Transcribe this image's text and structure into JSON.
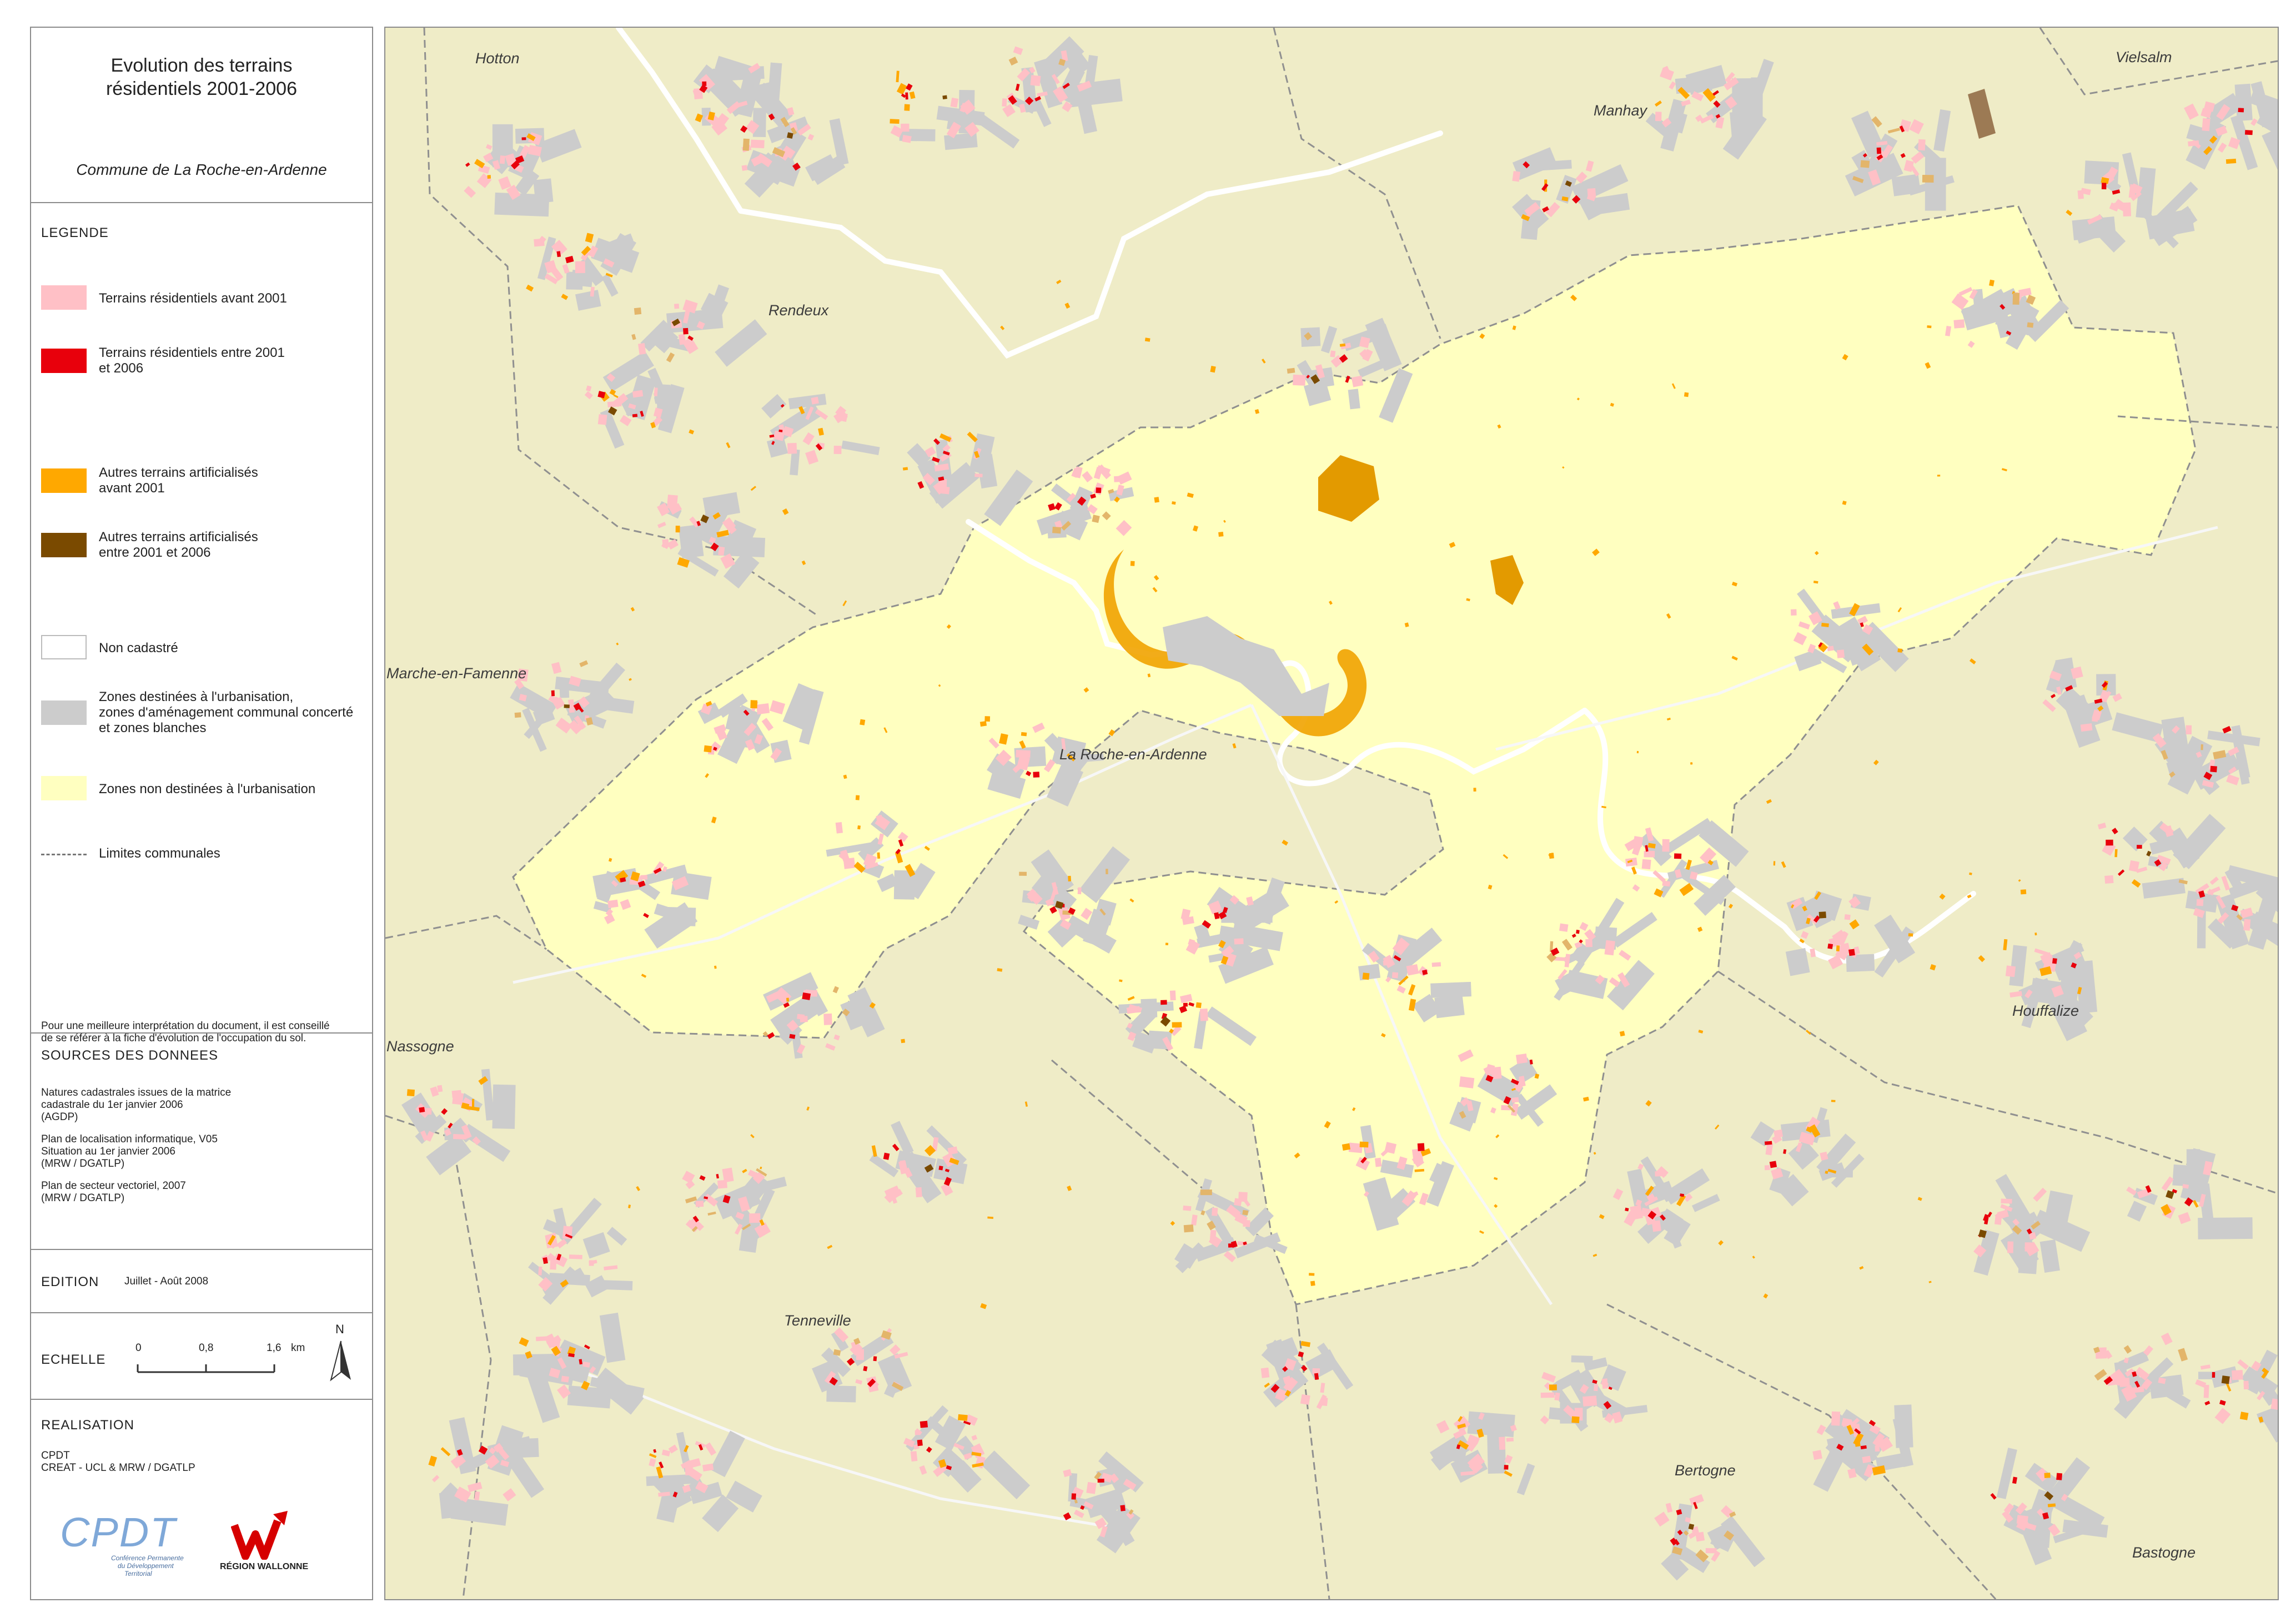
{
  "title_line1": "Evolution des terrains",
  "title_line2": "résidentiels 2001-2006",
  "commune": "Commune de La Roche-en-Ardenne",
  "legend": {
    "heading": "LEGENDE",
    "items": [
      {
        "label1": "Terrains résidentiels avant 2001",
        "label2": "",
        "color": "#ffc0c6"
      },
      {
        "label1": "Terrains résidentiels entre 2001",
        "label2": "et 2006",
        "color": "#e8000c"
      },
      {
        "label1": "Autres terrains artificialisés",
        "label2": "avant 2001",
        "color": "#ffa800"
      },
      {
        "label1": "Autres terrains artificialisés",
        "label2": "entre 2001 et 2006",
        "color": "#7a4a00"
      },
      {
        "label1": "Non cadastré",
        "label2": "",
        "color": "#ffffff"
      },
      {
        "label1": "Zones destinées à l'urbanisation,",
        "label2": "zones d'aménagement communal concerté",
        "label3": "et zones blanches",
        "color": "#cccccc"
      },
      {
        "label1": "Zones non destinées à l'urbanisation",
        "label2": "",
        "color": "#ffffc0"
      }
    ],
    "boundary_label": "Limites communales",
    "note1": "Pour une meilleure interprétation du document, il est conseillé",
    "note2": "de se référer à la fiche d'évolution de l'occupation du sol."
  },
  "sources": {
    "heading": "SOURCES DES DONNEES",
    "lines": [
      "Natures cadastrales issues de la matrice",
      "cadastrale du 1er janvier 2006",
      "(AGDP)",
      "Plan de localisation informatique, V05",
      "Situation au 1er janvier 2006",
      "(MRW / DGATLP)",
      "Plan de secteur vectoriel, 2007",
      "(MRW / DGATLP)"
    ]
  },
  "edition": {
    "heading": "EDITION",
    "value": "Juillet - Août 2008"
  },
  "scale": {
    "heading": "ECHELLE",
    "t0": "0",
    "t1": "0,8",
    "t2": "1,6",
    "unit": "km",
    "north": "N"
  },
  "realisation": {
    "heading": "REALISATION",
    "line1": "CPDT",
    "line2": "CREAT - UCL & MRW / DGATLP",
    "cpdt_logo": "CPDT",
    "cpdt_small1": "Conférence Permanente",
    "cpdt_small2": "du Développement",
    "cpdt_small3": "Territorial",
    "rw_logo": "RÉGION WALLONNE"
  },
  "places": {
    "hotton": "Hotton",
    "manhay": "Manhay",
    "vielsalm": "Vielsalm",
    "rendeux": "Rendeux",
    "marche": "Marche-en-Famenne",
    "laroche": "La Roche-en-Ardenne",
    "nassogne": "Nassogne",
    "houffalize": "Houffalize",
    "tenneville": "Tenneville",
    "bertogne": "Bertogne",
    "bastogne": "Bastogne"
  },
  "colors": {
    "outside": "#efecc7",
    "commune": "#ffffc0",
    "grey_zone": "#cccccc",
    "res_before": "#ffc0c6",
    "res_new": "#e8000c",
    "art_before": "#ffa800",
    "art_new": "#7a4a00",
    "river": "#ffffff"
  }
}
